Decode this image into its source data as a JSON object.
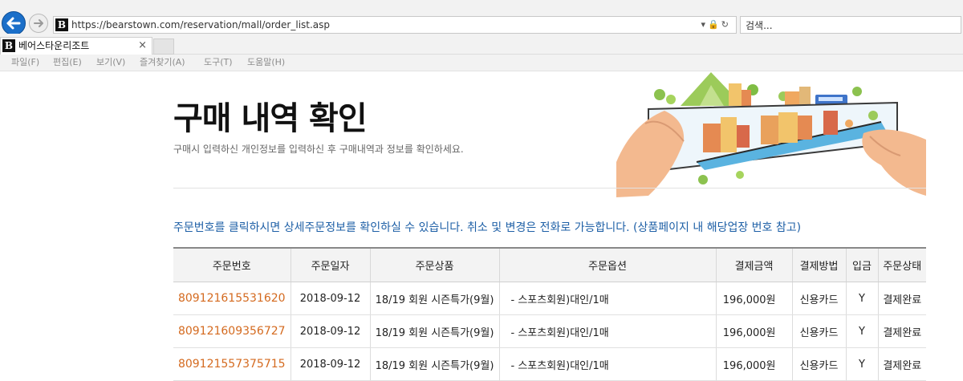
{
  "browser": {
    "url": "https://bearstown.com/reservation/mall/order_list.asp",
    "search_placeholder": "검색...",
    "favicon_letter": "B",
    "tab_title": "베어스타운리조트",
    "tab_close": "×",
    "menu": [
      "파일(F)",
      "편집(E)",
      "보기(V)",
      "즐겨찾기(A)",
      "도구(T)",
      "도움말(H)"
    ]
  },
  "page": {
    "title": "구매 내역 확인",
    "subtitle": "구매시 입력하신 개인정보를 입력하신 후 구매내역과 정보를 확인하세요.",
    "notice": "주문번호를 클릭하시면 상세주문정보를 확인하실 수 있습니다. 취소 및 변경은 전화로 가능합니다. (상품페이지 내 해당업장 번호 참고)"
  },
  "table": {
    "headers": [
      "주문번호",
      "주문일자",
      "주문상품",
      "주문옵션",
      "결제금액",
      "결제방법",
      "입금",
      "주문상태"
    ],
    "rows": [
      [
        "809121615531620",
        "2018-09-12",
        "18/19 회원 시즌특가(9월)",
        "- 스포츠회원)대인/1매",
        "196,000원",
        "신용카드",
        "Y",
        "결제완료"
      ],
      [
        "809121609356727",
        "2018-09-12",
        "18/19 회원 시즌특가(9월)",
        "- 스포츠회원)대인/1매",
        "196,000원",
        "신용카드",
        "Y",
        "결제완료"
      ],
      [
        "809121557375715",
        "2018-09-12",
        "18/19 회원 시즌특가(9월)",
        "- 스포츠회원)대인/1매",
        "196,000원",
        "신용카드",
        "Y",
        "결제완료"
      ]
    ]
  },
  "colors": {
    "accent_blue": "#1d5fa6",
    "order_link": "#d46a1f",
    "back_button": "#1b6fc9"
  }
}
